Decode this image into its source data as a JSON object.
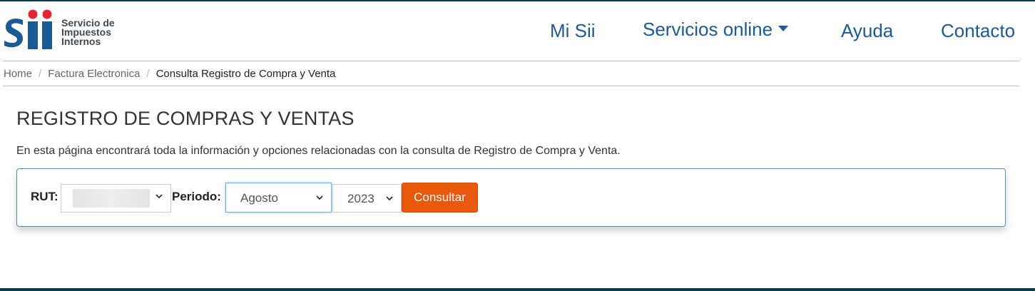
{
  "header": {
    "logo_lines": [
      "Servicio de",
      "Impuestos",
      "Internos"
    ],
    "nav": [
      {
        "label": "Mi Sii"
      },
      {
        "label": "Servicios online"
      },
      {
        "label": "Ayuda"
      },
      {
        "label": "Contacto"
      }
    ]
  },
  "breadcrumb": {
    "items": [
      "Home",
      "Factura Electronica",
      "Consulta Registro de Compra y Venta"
    ],
    "separator": "/"
  },
  "main": {
    "title": "REGISTRO DE COMPRAS Y VENTAS",
    "intro": "En esta página encontrará toda la información y opciones relacionadas con la consulta de Registro de Compra y Venta.",
    "form": {
      "rut_label": "RUT:",
      "periodo_label": "Periodo:",
      "month_value": "Agosto",
      "year_value": "2023",
      "submit_label": "Consultar"
    }
  },
  "colors": {
    "brand_blue": "#1a5a96",
    "button_orange": "#e8590c",
    "logo_red": "#e2262f"
  }
}
